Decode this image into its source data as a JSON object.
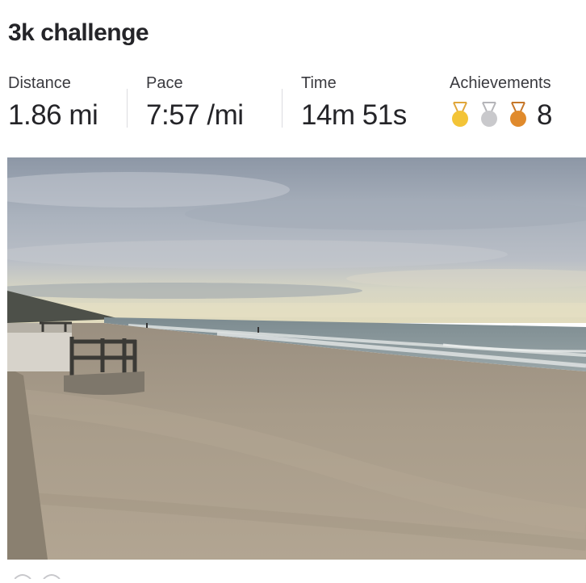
{
  "activity": {
    "title": "3k challenge"
  },
  "stats": [
    {
      "label": "Distance",
      "value": "1.86 mi"
    },
    {
      "label": "Pace",
      "value": "7:57 /mi"
    },
    {
      "label": "Time",
      "value": "14m 51s"
    }
  ],
  "achievements": {
    "label": "Achievements",
    "count": "8",
    "medals": [
      {
        "icon": "gold-medal-icon",
        "color": "#f3c437"
      },
      {
        "icon": "silver-medal-icon",
        "color": "#c9c9cc"
      },
      {
        "icon": "bronze-medal-icon",
        "color": "#e08a2c"
      }
    ]
  },
  "photo": {
    "icon": "beach-photo"
  }
}
